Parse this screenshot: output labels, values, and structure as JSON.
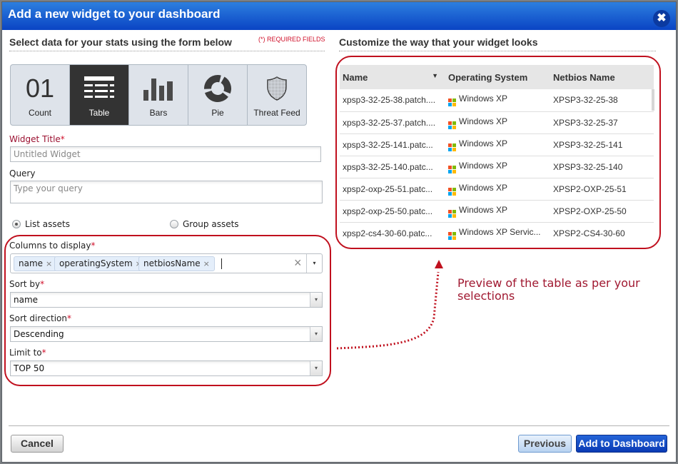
{
  "dialog": {
    "title": "Add a new widget to your dashboard",
    "close_icon": "close-icon"
  },
  "left": {
    "heading": "Select data for your stats using the form below",
    "required_note": "(*) REQUIRED FIELDS",
    "widget_types": [
      {
        "label": "Count",
        "icon": "count-01-icon",
        "glyph": "01",
        "active": false
      },
      {
        "label": "Table",
        "icon": "table-icon",
        "active": true
      },
      {
        "label": "Bars",
        "icon": "bar-chart-icon",
        "active": false
      },
      {
        "label": "Pie",
        "icon": "pie-chart-icon",
        "active": false
      },
      {
        "label": "Threat Feed",
        "icon": "shield-icon",
        "active": false
      }
    ],
    "widget_title": {
      "label": "Widget Title",
      "required": "*",
      "value": "",
      "placeholder": "Untitled Widget"
    },
    "query": {
      "label": "Query",
      "value": "",
      "placeholder": "Type your query"
    },
    "asset_mode": {
      "options": [
        "List assets",
        "Group assets"
      ],
      "selected": "List assets"
    },
    "columns": {
      "label": "Columns to display",
      "required": "*",
      "tags": [
        "name",
        "operatingSystem",
        "netbiosName"
      ],
      "remove_glyph": "×",
      "clear_glyph": "×",
      "dropdown_glyph": "▾"
    },
    "sort_by": {
      "label": "Sort by",
      "required": "*",
      "value": "name"
    },
    "sort_direction": {
      "label": "Sort direction",
      "required": "*",
      "value": "Descending"
    },
    "limit_to": {
      "label": "Limit to",
      "required": "*",
      "value": "TOP 50"
    },
    "select_arrow": "▾"
  },
  "right": {
    "heading": "Customize the way that your widget looks",
    "table": {
      "columns": [
        "Name",
        "Operating System",
        "Netbios Name"
      ],
      "sort_glyph": "▼",
      "rows": [
        {
          "name": "xpsp3-32-25-38.patch....",
          "os": "Windows XP",
          "netbios": "XPSP3-32-25-38"
        },
        {
          "name": "xpsp3-32-25-37.patch....",
          "os": "Windows XP",
          "netbios": "XPSP3-32-25-37"
        },
        {
          "name": "xpsp3-32-25-141.patc...",
          "os": "Windows XP",
          "netbios": "XPSP3-32-25-141"
        },
        {
          "name": "xpsp3-32-25-140.patc...",
          "os": "Windows XP",
          "netbios": "XPSP3-32-25-140"
        },
        {
          "name": "xpsp2-oxp-25-51.patc...",
          "os": "Windows XP",
          "netbios": "XPSP2-OXP-25-51"
        },
        {
          "name": "xpsp2-oxp-25-50.patc...",
          "os": "Windows XP",
          "netbios": "XPSP2-OXP-25-50"
        },
        {
          "name": "xpsp2-cs4-30-60.patc...",
          "os": "Windows XP Servic...",
          "netbios": "XPSP2-CS4-30-60"
        }
      ]
    },
    "annotation": "Preview of the table as per your selections"
  },
  "footer": {
    "cancel": "Cancel",
    "previous": "Previous",
    "add": "Add to Dashboard"
  },
  "colors": {
    "title_bar": "#0a44c4",
    "annotation_red": "#c0101e",
    "required_red": "#d0102a",
    "active_tile": "#333333",
    "windows_logo": [
      "#f25022",
      "#7fba00",
      "#00a4ef",
      "#ffb900"
    ]
  }
}
